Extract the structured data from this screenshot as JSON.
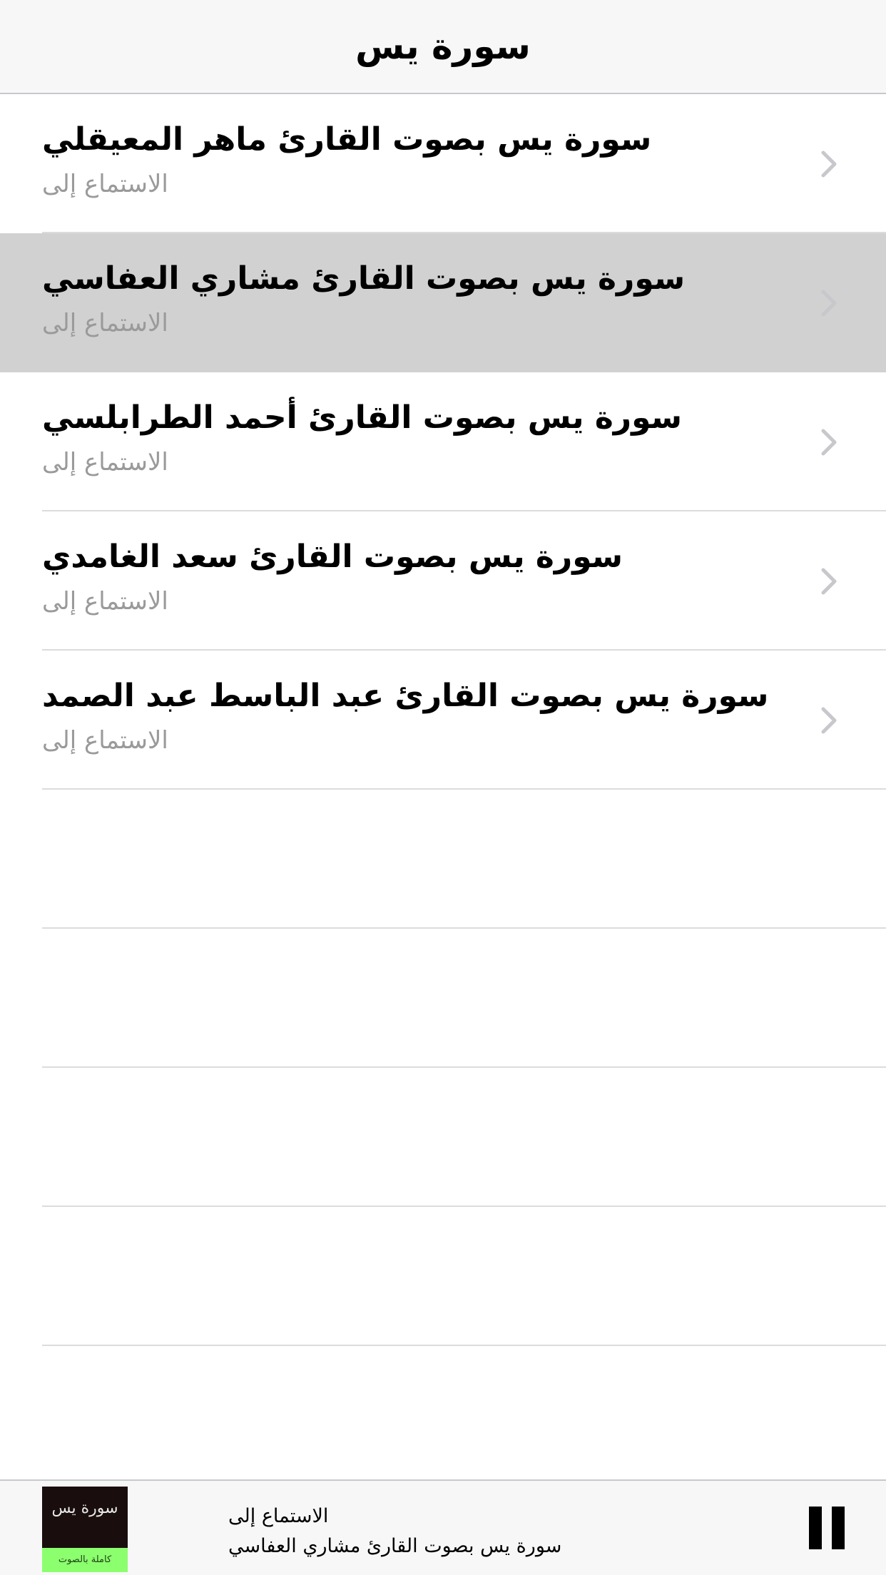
{
  "nav": {
    "title": "سورة يس"
  },
  "list": {
    "items": [
      {
        "title": "سورة يس بصوت القارئ ماهر المعيقلي",
        "subtitle": "الاستماع إلى",
        "selected": false
      },
      {
        "title": "سورة يس بصوت القارئ مشاري العفاسي",
        "subtitle": "الاستماع إلى",
        "selected": true
      },
      {
        "title": "سورة يس بصوت القارئ أحمد الطرابلسي",
        "subtitle": "الاستماع إلى",
        "selected": false
      },
      {
        "title": "سورة يس بصوت القارئ سعد الغامدي",
        "subtitle": "الاستماع إلى",
        "selected": false
      },
      {
        "title": "سورة يس بصوت القارئ عبد الباسط عبد الصمد",
        "subtitle": "الاستماع إلى",
        "selected": false
      }
    ],
    "chevron_icon": "chevron-right-icon",
    "selected_color": "#d1d1d1"
  },
  "player": {
    "artwork": {
      "top_text": "سورة يس",
      "band_text": "كاملة بالصوت",
      "band_color": "#8cff6e"
    },
    "line1": "الاستماع إلى",
    "line2": "سورة يس بصوت القارئ مشاري العفاسي",
    "pause_icon": "pause-icon"
  }
}
